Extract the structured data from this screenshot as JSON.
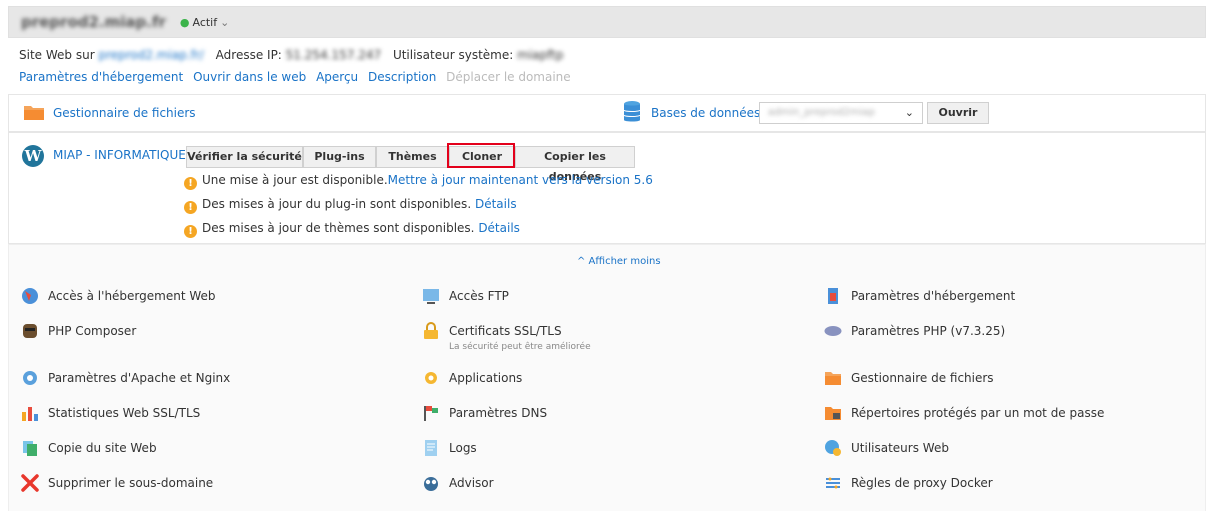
{
  "header": {
    "domain": "preprod2.miap.fr",
    "status": "Actif",
    "status_chevron": "⌄"
  },
  "info": {
    "site_label": "Site Web sur",
    "site_value": "preprod2.miap.fr/",
    "ip_label": "Adresse IP:",
    "ip_value": "51.254.157.247",
    "user_label": "Utilisateur système:",
    "user_value": "miapftp"
  },
  "links": [
    "Paramètres d'hébergement",
    "Ouvrir dans le web",
    "Aperçu",
    "Description",
    "Déplacer le domaine"
  ],
  "files": {
    "label": "Gestionnaire de fichiers"
  },
  "database": {
    "label": "Bases de données",
    "selected": "admin_preprod2miap",
    "open_label": "Ouvrir"
  },
  "wordpress": {
    "site_name": "MIAP - INFORMATIQUE",
    "buttons": [
      "Vérifier la sécurité",
      "Plug-ins",
      "Thèmes",
      "Cloner",
      "Copier les données"
    ],
    "notices": [
      {
        "text": "Une mise à jour est disponible.",
        "link": "Mettre à jour maintenant vers la version 5.6"
      },
      {
        "text": "Des mises à jour du plug-in sont disponibles.",
        "link": "Détails"
      },
      {
        "text": "Des mises à jour de thèmes sont disponibles.",
        "link": "Détails"
      }
    ],
    "warn_glyph": "!"
  },
  "toggle": "^ Afficher moins",
  "tools": {
    "col1": [
      "Accès à l'hébergement Web",
      "PHP Composer",
      "Paramètres d'Apache et Nginx",
      "Statistiques Web SSL/TLS",
      "Copie du site Web",
      "Supprimer le sous-domaine"
    ],
    "col2": [
      "Accès FTP",
      "Certificats SSL/TLS",
      "Applications",
      "Paramètres DNS",
      "Logs",
      "Advisor"
    ],
    "col2_sub": "La sécurité peut être améliorée",
    "col3": [
      "Paramètres d'hébergement",
      "Paramètres PHP (v7.3.25)",
      "Gestionnaire de fichiers",
      "Répertoires protégés par un mot de passe",
      "Utilisateurs Web",
      "Règles de proxy Docker"
    ]
  },
  "colors": {
    "accent": "#1a73c7",
    "highlight": "#e3001b",
    "warning": "#f5a623",
    "active": "#3bb34a"
  }
}
